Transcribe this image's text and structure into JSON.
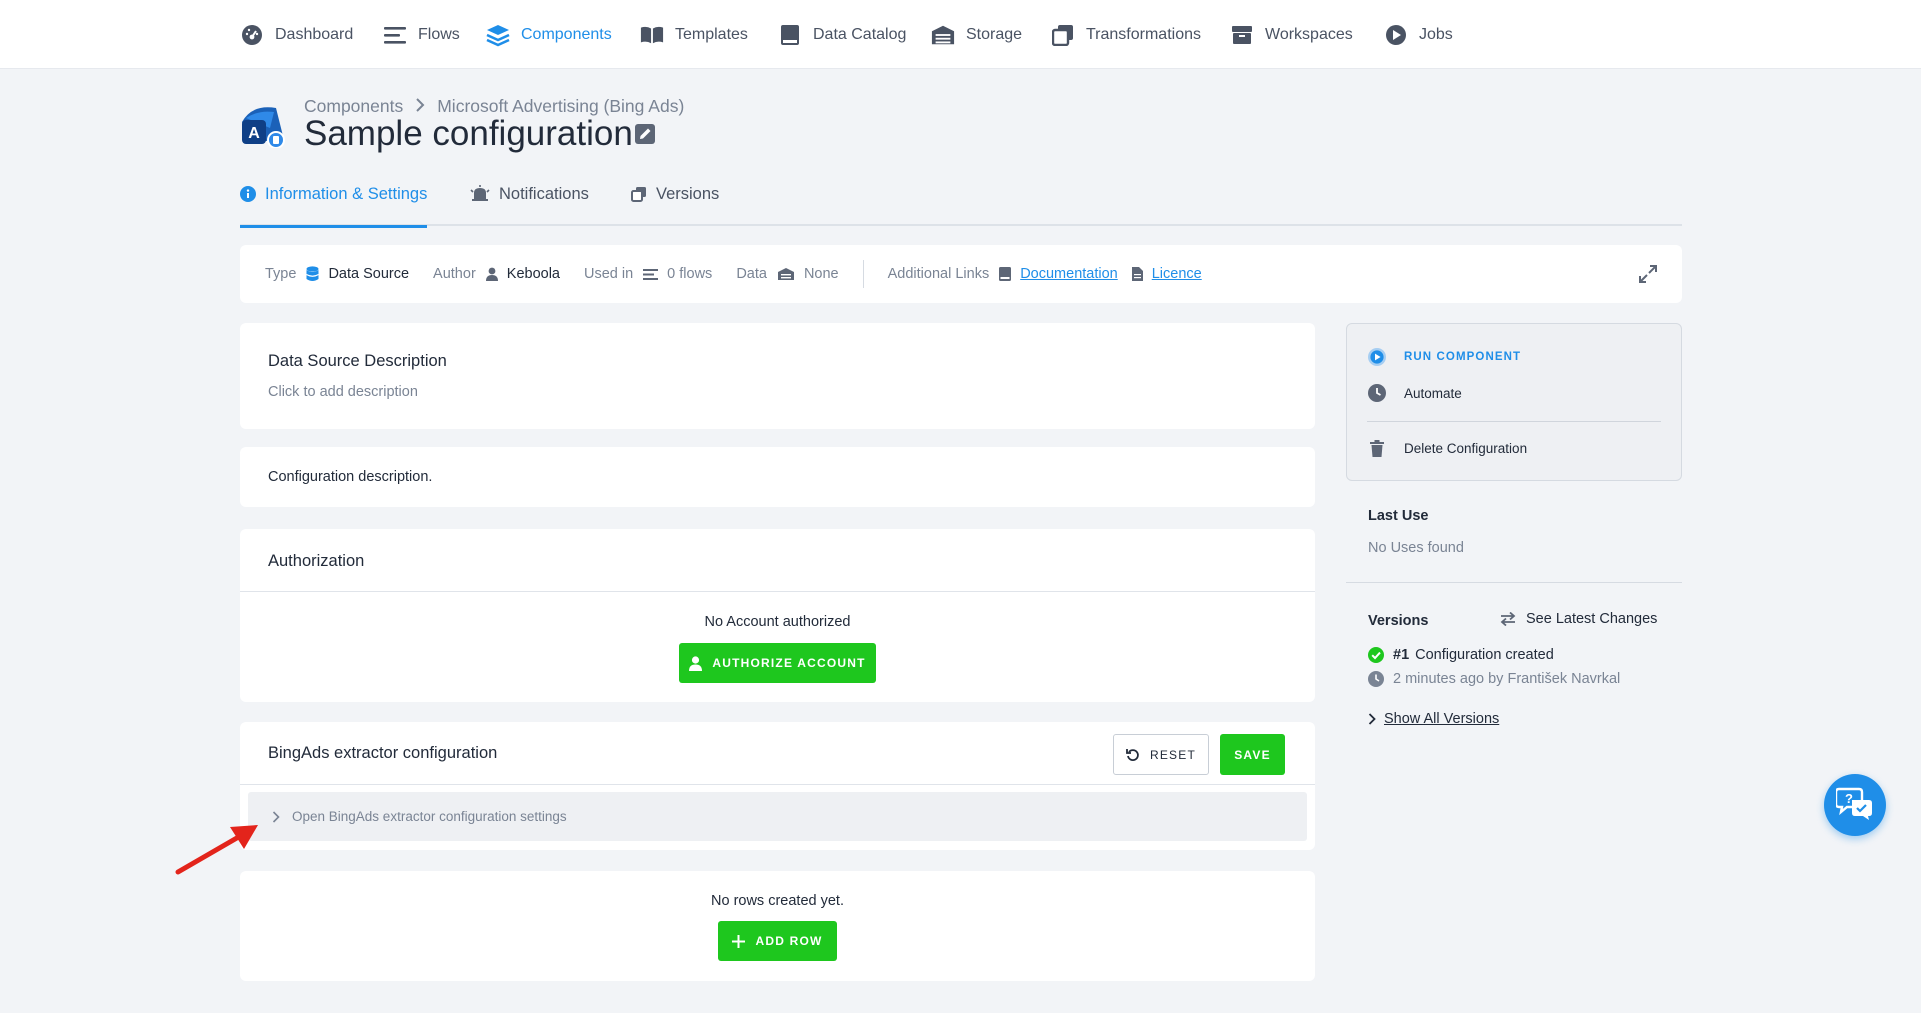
{
  "nav": {
    "items": [
      {
        "label": "Dashboard",
        "icon": "dashboard-icon"
      },
      {
        "label": "Flows",
        "icon": "flows-icon"
      },
      {
        "label": "Components",
        "icon": "components-icon",
        "active": true
      },
      {
        "label": "Templates",
        "icon": "templates-icon"
      },
      {
        "label": "Data Catalog",
        "icon": "data-catalog-icon"
      },
      {
        "label": "Storage",
        "icon": "storage-icon"
      },
      {
        "label": "Transformations",
        "icon": "transformations-icon"
      },
      {
        "label": "Workspaces",
        "icon": "workspaces-icon"
      },
      {
        "label": "Jobs",
        "icon": "jobs-icon"
      }
    ]
  },
  "header": {
    "breadcrumb": [
      "Components",
      "Microsoft Advertising (Bing Ads)"
    ],
    "title": "Sample configuration"
  },
  "tabs": [
    {
      "label": "Information & Settings",
      "active": true
    },
    {
      "label": "Notifications"
    },
    {
      "label": "Versions"
    }
  ],
  "infobar": {
    "type_label": "Type",
    "type_value": "Data Source",
    "author_label": "Author",
    "author_value": "Keboola",
    "used_label": "Used in",
    "used_value": "0 flows",
    "data_label": "Data",
    "data_value": "None",
    "links_label": "Additional Links",
    "documentation": "Documentation",
    "licence": "Licence"
  },
  "description_card": {
    "title": "Data Source Description",
    "placeholder": "Click to add description"
  },
  "config_description": "Configuration description.",
  "authorization": {
    "title": "Authorization",
    "status": "No Account authorized",
    "button": "AUTHORIZE ACCOUNT"
  },
  "extractor": {
    "title": "BingAds extractor configuration",
    "reset": "RESET",
    "save": "SAVE",
    "collapse_label": "Open BingAds extractor configuration settings"
  },
  "rows": {
    "empty": "No rows created yet.",
    "add": "ADD ROW"
  },
  "sidebar": {
    "run": "RUN COMPONENT",
    "automate": "Automate",
    "delete": "Delete Configuration",
    "last_use_title": "Last Use",
    "last_use_value": "No Uses found",
    "versions_title": "Versions",
    "see_latest": "See Latest Changes",
    "version_number": "#1",
    "version_text": "Configuration created",
    "version_meta": "2 minutes ago by František Navrkal",
    "show_all": "Show All Versions"
  },
  "colors": {
    "accent": "#1f8ee8",
    "success": "#1ec71e"
  }
}
